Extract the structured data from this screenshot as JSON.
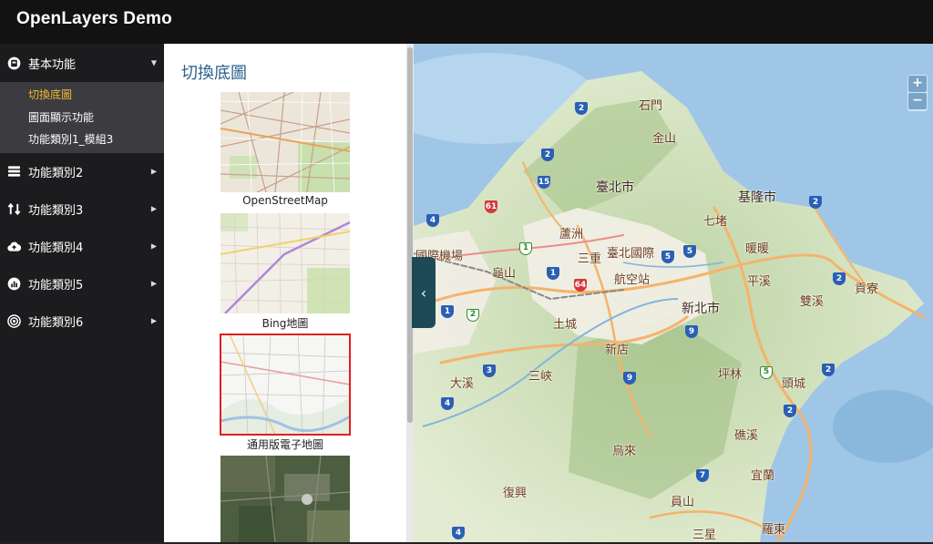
{
  "app": {
    "title": "OpenLayers Demo"
  },
  "sidebar": {
    "items": [
      {
        "label": "基本功能",
        "icon": "building-icon",
        "expanded": true,
        "children": [
          {
            "label": "切換底圖",
            "active": true
          },
          {
            "label": "圖面顯示功能",
            "active": false
          },
          {
            "label": "功能類別1_模組3",
            "active": false
          }
        ]
      },
      {
        "label": "功能類別2",
        "icon": "layers-icon"
      },
      {
        "label": "功能類別3",
        "icon": "swap-arrows-icon"
      },
      {
        "label": "功能類別4",
        "icon": "cloud-upload-icon"
      },
      {
        "label": "功能類別5",
        "icon": "chart-icon"
      },
      {
        "label": "功能類別6",
        "icon": "target-icon"
      }
    ]
  },
  "panel": {
    "title": "切換底圖",
    "basemaps": [
      {
        "label": "OpenStreetMap",
        "selected": false
      },
      {
        "label": "Bing地圖",
        "selected": false
      },
      {
        "label": "通用版電子地圖",
        "selected": true
      },
      {
        "label": "",
        "selected": false
      }
    ]
  },
  "map": {
    "zoom_in": "+",
    "zoom_out": "−",
    "collapse": "‹",
    "labels": {
      "shimen": "石門",
      "jinshan": "金山",
      "taipei": "臺北市",
      "keelung": "基隆市",
      "luzhou": "蘆洲",
      "qidu": "七堵",
      "sanchong": "三重",
      "airport_tw": "臺北國際",
      "airport_sub": "航空站",
      "nuannuan": "暖暖",
      "pingxi": "平溪",
      "guishan": "龜山",
      "intl_airport": "國際機場",
      "newtaipei": "新北市",
      "tucheng": "土城",
      "shuangxi": "雙溪",
      "gongliao": "貢寮",
      "xindian": "新店",
      "pinglin": "坪林",
      "daxi": "大溪",
      "sanxia": "三峽",
      "toucheng": "頭城",
      "jiaoxi": "礁溪",
      "wulai": "烏來",
      "yilan": "宜蘭",
      "fuxing": "復興",
      "yuanshan": "員山",
      "sanxing": "三星",
      "luodong": "羅東"
    }
  },
  "colors": {
    "accent": "#f4b731",
    "title": "#2b5f8e",
    "header": "#121212",
    "sidebar": "#1c1c1e",
    "collapse": "#1e4a57"
  }
}
